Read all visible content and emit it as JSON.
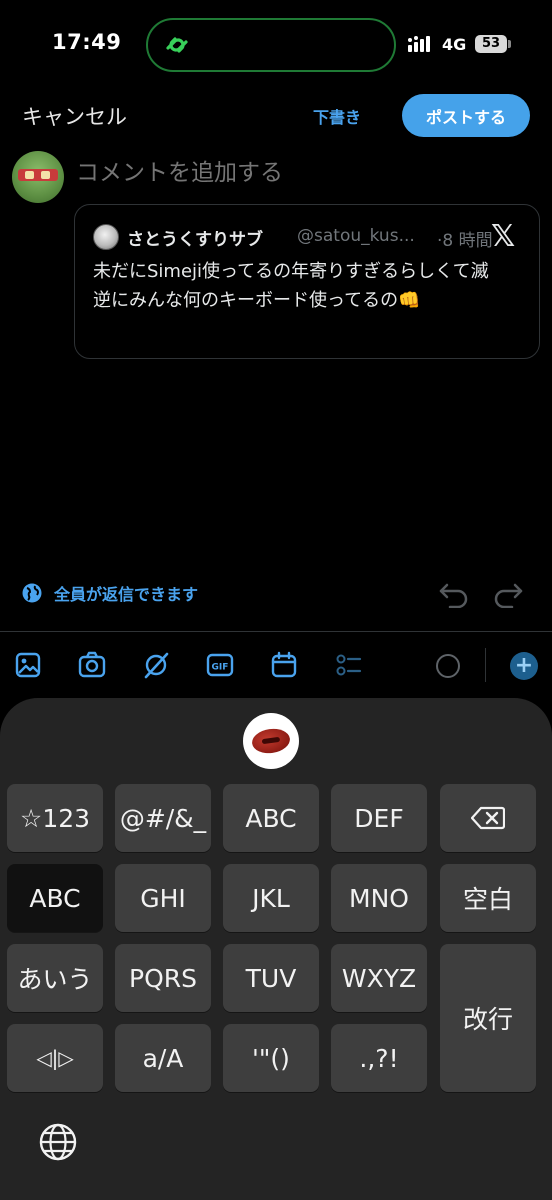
{
  "status_bar": {
    "time": "17:49",
    "network": "4G",
    "battery": "53"
  },
  "compose": {
    "cancel_label": "キャンセル",
    "draft_label": "下書き",
    "post_label": "ポストする",
    "comment_placeholder": "コメントを追加する"
  },
  "quoted_post": {
    "author_name": "さとうくすりサブ",
    "handle": "@satou_kus...",
    "time": "·8 時間",
    "logo": "𝕏",
    "text_line1": "未だにSimeji使ってるの年寄りすぎるらしくて滅",
    "text_line2": "逆にみんな何のキーボード使ってるの👊"
  },
  "reply_settings": {
    "label": "全員が返信できます"
  },
  "toolbar": {
    "icons": [
      "image-icon",
      "camera-icon",
      "gif-icon",
      "poll-icon",
      "schedule-icon",
      "location-icon"
    ],
    "add_label": "+"
  },
  "keyboard": {
    "logo": "simeji-logo",
    "keys": {
      "symbols_num": "☆123",
      "symbols": "@#/&_",
      "abc": "ABC",
      "def": "DEF",
      "backspace": "⌫",
      "abc_mode": "ABC",
      "ghi": "GHI",
      "jkl": "JKL",
      "mno": "MNO",
      "space": "空白",
      "kana_mode": "あいう",
      "pqrs": "PQRS",
      "tuv": "TUV",
      "wxyz": "WXYZ",
      "enter": "改行",
      "cursor": "◁|▷",
      "case": "a/A",
      "quotes": "'\"()",
      "punct": ".,?!"
    }
  },
  "colors": {
    "accent": "#45a2ea",
    "link": "#4aa3ee",
    "island_border": "#1f7a35",
    "keyboard_bg": "#242424",
    "key_bg": "#3e3e3e"
  }
}
